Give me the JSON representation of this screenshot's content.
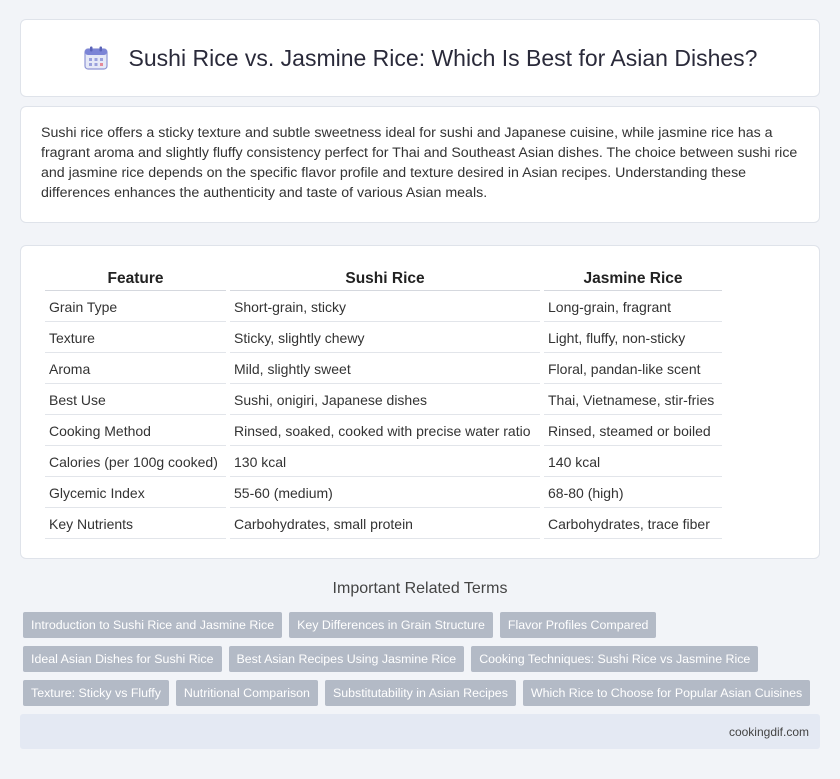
{
  "header": {
    "icon": "calendar-icon",
    "title": "Sushi Rice vs. Jasmine Rice: Which Is Best for Asian Dishes?"
  },
  "intro": {
    "text": "Sushi rice offers a sticky texture and subtle sweetness ideal for sushi and Japanese cuisine, while jasmine rice has a fragrant aroma and slightly fluffy consistency perfect for Thai and Southeast Asian dishes. The choice between sushi rice and jasmine rice depends on the specific flavor profile and texture desired in Asian recipes. Understanding these differences enhances the authenticity and taste of various Asian meals."
  },
  "table": {
    "headers": [
      "Feature",
      "Sushi Rice",
      "Jasmine Rice"
    ],
    "rows": [
      [
        "Grain Type",
        "Short-grain, sticky",
        "Long-grain, fragrant"
      ],
      [
        "Texture",
        "Sticky, slightly chewy",
        "Light, fluffy, non-sticky"
      ],
      [
        "Aroma",
        "Mild, slightly sweet",
        "Floral, pandan-like scent"
      ],
      [
        "Best Use",
        "Sushi, onigiri, Japanese dishes",
        "Thai, Vietnamese, stir-fries"
      ],
      [
        "Cooking Method",
        "Rinsed, soaked, cooked with precise water ratio",
        "Rinsed, steamed or boiled"
      ],
      [
        "Calories (per 100g cooked)",
        "130 kcal",
        "140 kcal"
      ],
      [
        "Glycemic Index",
        "55-60 (medium)",
        "68-80 (high)"
      ],
      [
        "Key Nutrients",
        "Carbohydrates, small protein",
        "Carbohydrates, trace fiber"
      ]
    ]
  },
  "related": {
    "title": "Important Related Terms",
    "rows": [
      [
        "Introduction to Sushi Rice and Jasmine Rice",
        "Key Differences in Grain Structure",
        "Flavor Profiles Compared"
      ],
      [
        "Ideal Asian Dishes for Sushi Rice",
        "Best Asian Recipes Using Jasmine Rice",
        "Cooking Techniques: Sushi Rice vs Jasmine Rice"
      ],
      [
        "Texture: Sticky vs Fluffy",
        "Nutritional Comparison",
        "Substitutability in Asian Recipes",
        "Which Rice to Choose for Popular Asian Cuisines"
      ]
    ]
  },
  "footer": {
    "site": "cookingdif.com"
  },
  "colors": {
    "tag_bg": "#b3bac6",
    "footer_bg": "#e4e9f3",
    "page_bg": "#f2f4f8"
  }
}
